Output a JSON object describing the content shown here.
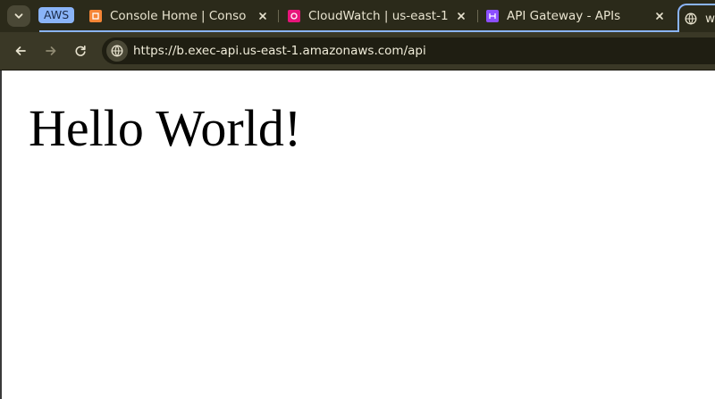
{
  "tabstrip": {
    "tab_group": {
      "label": "AWS",
      "color": "#8ab4f8"
    },
    "tabs": [
      {
        "title": "Console Home | Console",
        "favicon": "aws-console-icon",
        "favicon_color": "#f58536"
      },
      {
        "title": "CloudWatch | us-east-1",
        "favicon": "cloudwatch-icon",
        "favicon_color": "#e7157b"
      },
      {
        "title": "API Gateway - APIs",
        "favicon": "api-gateway-icon",
        "favicon_color": "#8c4fff"
      },
      {
        "title": "w",
        "favicon": "globe-icon",
        "active": true
      }
    ]
  },
  "toolbar": {
    "url": "https://b.exec-api.us-east-1.amazonaws.com/api",
    "back_icon": "arrow-left-icon",
    "forward_icon": "arrow-right-icon",
    "reload_icon": "reload-icon",
    "site_info_icon": "globe-icon"
  },
  "page": {
    "heading": "Hello World!"
  }
}
